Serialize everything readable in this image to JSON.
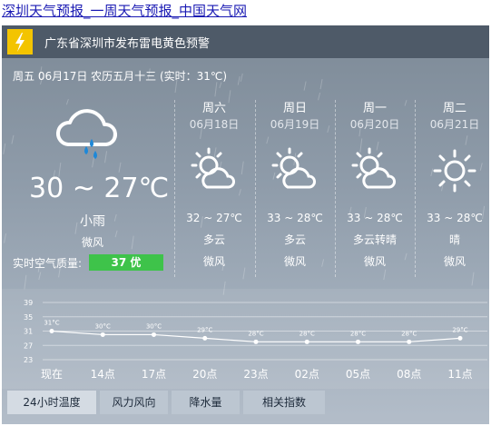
{
  "page_title": "深圳天气预报_一周天气预报_中国天气网",
  "alert": {
    "text": "广东省深圳市发布雷电黄色预警",
    "color": "#f3c400"
  },
  "today": {
    "header": "周五 06月17日 农历五月十三 (实时：31℃)",
    "temp": "30 ~ 27℃",
    "weather": "小雨",
    "wind": "微风",
    "air_quality_label": "实时空气质量:",
    "air_quality_value": "37 优",
    "air_quality_color": "#3ec34a",
    "icon": "cloud-rain-icon"
  },
  "forecast": [
    {
      "day": "周六",
      "date": "06月18日",
      "temp": "32 ~ 27℃",
      "weather": "多云",
      "wind": "微风",
      "icon": "sun-cloud-icon"
    },
    {
      "day": "周日",
      "date": "06月19日",
      "temp": "33 ~ 28℃",
      "weather": "多云",
      "wind": "微风",
      "icon": "sun-cloud-icon"
    },
    {
      "day": "周一",
      "date": "06月20日",
      "temp": "33 ~ 28℃",
      "weather": "多云转晴",
      "wind": "微风",
      "icon": "sun-cloud-icon"
    },
    {
      "day": "周二",
      "date": "06月21日",
      "temp": "33 ~ 28℃",
      "weather": "晴",
      "wind": "微风",
      "icon": "sun-icon"
    }
  ],
  "chart_data": {
    "type": "line",
    "categories": [
      "现在",
      "14点",
      "17点",
      "20点",
      "23点",
      "02点",
      "05点",
      "08点",
      "11点"
    ],
    "values": [
      31,
      30,
      30,
      29,
      28,
      28,
      28,
      28,
      29
    ],
    "point_labels": [
      "31°C",
      "30°C",
      "30°C",
      "29°C",
      "28°C",
      "28°C",
      "28°C",
      "28°C",
      "29°C"
    ],
    "yticks": [
      "39",
      "35",
      "31",
      "27",
      "23"
    ],
    "ylim": [
      23,
      39
    ],
    "grid": true
  },
  "tabs": [
    {
      "label": "24小时温度",
      "active": true
    },
    {
      "label": "风力风向",
      "active": false
    },
    {
      "label": "降水量",
      "active": false
    },
    {
      "label": "相关指数",
      "active": false
    }
  ]
}
